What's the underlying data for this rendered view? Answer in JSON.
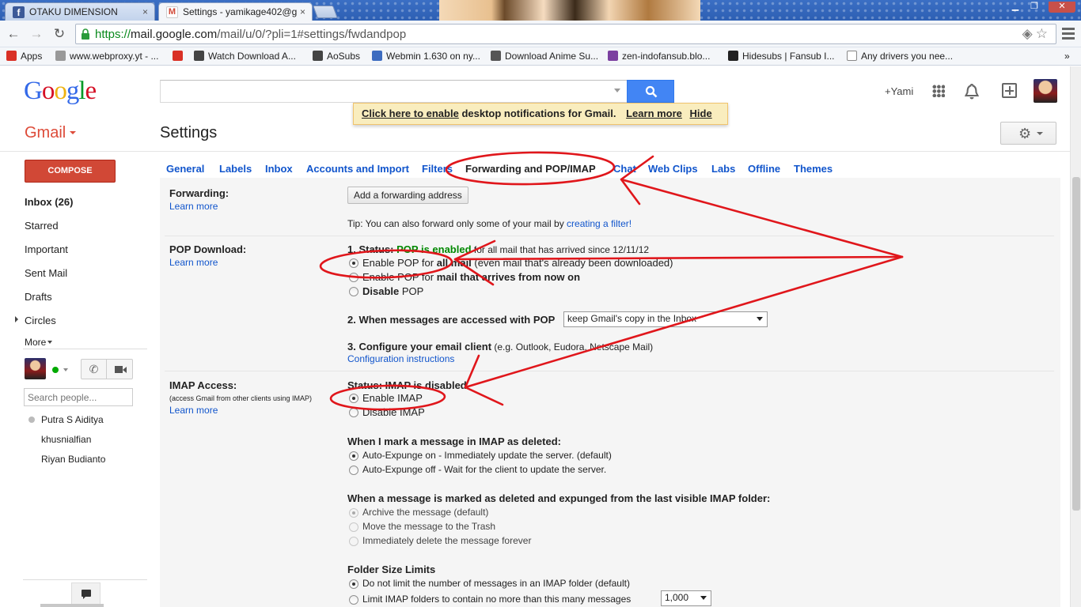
{
  "browser": {
    "tabs": [
      {
        "title": "OTAKU DIMENSION",
        "favicon": "facebook-icon"
      },
      {
        "title": "Settings - yamikage402@g",
        "favicon": "gmail-icon"
      }
    ],
    "close_glyph": "×",
    "url": {
      "scheme": "https://",
      "host": "mail.google.com",
      "path": "/mail/u/0/?pli=1#settings/fwdandpop"
    },
    "bookmarks": [
      {
        "label": "Apps",
        "icon": "apps-grid-icon",
        "color": "#d93025"
      },
      {
        "label": "www.webproxy.yt - ...",
        "icon": "page-icon",
        "color": "#999999"
      },
      {
        "label": "",
        "icon": "red-circle-icon",
        "color": "#d93025"
      },
      {
        "label": "Watch Download A...",
        "icon": "folder-icon",
        "color": "#444444"
      },
      {
        "label": "AoSubs",
        "icon": "aosubs-icon",
        "color": "#444444"
      },
      {
        "label": "Webmin 1.630 on ny...",
        "icon": "webmin-icon",
        "color": "#3d6cc0"
      },
      {
        "label": "Download Anime Su...",
        "icon": "download-icon",
        "color": "#555555"
      },
      {
        "label": "zen-indofansub.blo...",
        "icon": "zen-icon",
        "color": "#7b3fa0"
      },
      {
        "label": "Hidesubs | Fansub I...",
        "icon": "hidesubs-icon",
        "color": "#222222"
      },
      {
        "label": "Any drivers you nee...",
        "icon": "blank-page-icon",
        "color": "#ffffff"
      }
    ],
    "overflow": "»"
  },
  "header": {
    "logo": "Google",
    "logo_colors": [
      "#3369e8",
      "#d50f25",
      "#eeb211",
      "#3369e8",
      "#009925",
      "#d50f25"
    ],
    "plus_name": "+Yami",
    "notification": {
      "link": "Click here to enable",
      "text": "desktop notifications for Gmail.",
      "learn_more": "Learn more",
      "hide": "Hide"
    }
  },
  "gmail": {
    "label": "Gmail",
    "page_title": "Settings",
    "compose": "COMPOSE",
    "nav": [
      {
        "label": "Inbox (26)",
        "bold": true
      },
      {
        "label": "Starred"
      },
      {
        "label": "Important"
      },
      {
        "label": "Sent Mail"
      },
      {
        "label": "Drafts"
      },
      {
        "label": "Circles"
      }
    ],
    "more": "More",
    "people_search_placeholder": "Search people...",
    "contacts": [
      "Putra S Aiditya",
      "khusnialfian",
      "Riyan Budianto"
    ]
  },
  "settings_tabs": [
    "General",
    "Labels",
    "Inbox",
    "Accounts and Import",
    "Filters",
    "Forwarding and POP/IMAP",
    "Chat",
    "Web Clips",
    "Labs",
    "Offline",
    "Themes"
  ],
  "active_tab": "Forwarding and POP/IMAP",
  "forwarding": {
    "label": "Forwarding:",
    "learn_more": "Learn more",
    "add_button": "Add a forwarding address",
    "tip_prefix": "Tip: You can also forward only some of your mail by ",
    "tip_link": "creating a filter!"
  },
  "pop": {
    "label": "POP Download:",
    "learn_more": "Learn more",
    "status_prefix": "1. Status: ",
    "status_value": "POP is enabled",
    "status_suffix": " for all mail that has arrived since 12/11/12",
    "options": [
      {
        "pre": "Enable POP for ",
        "strong": "all mail",
        "post": " (even mail that's already been downloaded)",
        "selected": true
      },
      {
        "pre": "Enable POP for ",
        "strong": "mail that arrives from now on",
        "post": "",
        "selected": false
      },
      {
        "pre": "",
        "strong": "Disable",
        "post": " POP",
        "selected": false
      }
    ],
    "step2_label": "2. When messages are accessed with POP",
    "step2_select": "keep Gmail's copy in the Inbox",
    "step3_label": "3. Configure your email client",
    "step3_suffix": " (e.g. Outlook, Eudora, Netscape Mail)",
    "config_link": "Configuration instructions"
  },
  "imap": {
    "label": "IMAP Access:",
    "note": "(access Gmail from other clients using IMAP)",
    "learn_more": "Learn more",
    "status": "Status: IMAP is disabled",
    "options": [
      {
        "label": "Enable IMAP",
        "selected": true
      },
      {
        "label": "Disable IMAP",
        "selected": false
      }
    ],
    "deleted_heading": "When I mark a message in IMAP as deleted:",
    "deleted_options": [
      {
        "label": "Auto-Expunge on - Immediately update the server. (default)",
        "selected": true
      },
      {
        "label": "Auto-Expunge off - Wait for the client to update the server.",
        "selected": false
      }
    ],
    "expunged_heading": "When a message is marked as deleted and expunged from the last visible IMAP folder:",
    "expunged_options": [
      {
        "label": "Archive the message (default)",
        "selected": true
      },
      {
        "label": "Move the message to the Trash",
        "selected": false
      },
      {
        "label": "Immediately delete the message forever",
        "selected": false
      }
    ],
    "folder_heading": "Folder Size Limits",
    "folder_options": [
      {
        "label": "Do not limit the number of messages in an IMAP folder (default)",
        "selected": true
      },
      {
        "label": "Limit IMAP folders to contain no more than this many messages",
        "selected": false
      }
    ],
    "folder_limit": "1,000"
  },
  "annotation_color": "#e0161b"
}
